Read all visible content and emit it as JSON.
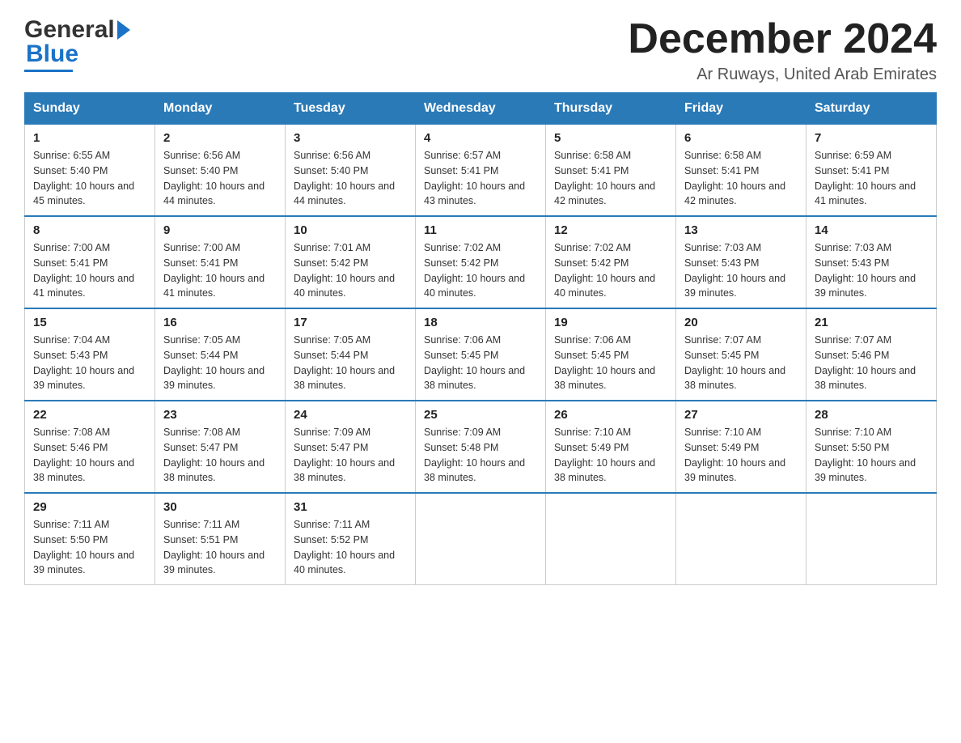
{
  "header": {
    "logo_general": "General",
    "logo_blue": "Blue",
    "month_title": "December 2024",
    "subtitle": "Ar Ruways, United Arab Emirates"
  },
  "weekdays": [
    "Sunday",
    "Monday",
    "Tuesday",
    "Wednesday",
    "Thursday",
    "Friday",
    "Saturday"
  ],
  "weeks": [
    [
      {
        "day": "1",
        "sunrise": "6:55 AM",
        "sunset": "5:40 PM",
        "daylight": "10 hours and 45 minutes."
      },
      {
        "day": "2",
        "sunrise": "6:56 AM",
        "sunset": "5:40 PM",
        "daylight": "10 hours and 44 minutes."
      },
      {
        "day": "3",
        "sunrise": "6:56 AM",
        "sunset": "5:40 PM",
        "daylight": "10 hours and 44 minutes."
      },
      {
        "day": "4",
        "sunrise": "6:57 AM",
        "sunset": "5:41 PM",
        "daylight": "10 hours and 43 minutes."
      },
      {
        "day": "5",
        "sunrise": "6:58 AM",
        "sunset": "5:41 PM",
        "daylight": "10 hours and 42 minutes."
      },
      {
        "day": "6",
        "sunrise": "6:58 AM",
        "sunset": "5:41 PM",
        "daylight": "10 hours and 42 minutes."
      },
      {
        "day": "7",
        "sunrise": "6:59 AM",
        "sunset": "5:41 PM",
        "daylight": "10 hours and 41 minutes."
      }
    ],
    [
      {
        "day": "8",
        "sunrise": "7:00 AM",
        "sunset": "5:41 PM",
        "daylight": "10 hours and 41 minutes."
      },
      {
        "day": "9",
        "sunrise": "7:00 AM",
        "sunset": "5:41 PM",
        "daylight": "10 hours and 41 minutes."
      },
      {
        "day": "10",
        "sunrise": "7:01 AM",
        "sunset": "5:42 PM",
        "daylight": "10 hours and 40 minutes."
      },
      {
        "day": "11",
        "sunrise": "7:02 AM",
        "sunset": "5:42 PM",
        "daylight": "10 hours and 40 minutes."
      },
      {
        "day": "12",
        "sunrise": "7:02 AM",
        "sunset": "5:42 PM",
        "daylight": "10 hours and 40 minutes."
      },
      {
        "day": "13",
        "sunrise": "7:03 AM",
        "sunset": "5:43 PM",
        "daylight": "10 hours and 39 minutes."
      },
      {
        "day": "14",
        "sunrise": "7:03 AM",
        "sunset": "5:43 PM",
        "daylight": "10 hours and 39 minutes."
      }
    ],
    [
      {
        "day": "15",
        "sunrise": "7:04 AM",
        "sunset": "5:43 PM",
        "daylight": "10 hours and 39 minutes."
      },
      {
        "day": "16",
        "sunrise": "7:05 AM",
        "sunset": "5:44 PM",
        "daylight": "10 hours and 39 minutes."
      },
      {
        "day": "17",
        "sunrise": "7:05 AM",
        "sunset": "5:44 PM",
        "daylight": "10 hours and 38 minutes."
      },
      {
        "day": "18",
        "sunrise": "7:06 AM",
        "sunset": "5:45 PM",
        "daylight": "10 hours and 38 minutes."
      },
      {
        "day": "19",
        "sunrise": "7:06 AM",
        "sunset": "5:45 PM",
        "daylight": "10 hours and 38 minutes."
      },
      {
        "day": "20",
        "sunrise": "7:07 AM",
        "sunset": "5:45 PM",
        "daylight": "10 hours and 38 minutes."
      },
      {
        "day": "21",
        "sunrise": "7:07 AM",
        "sunset": "5:46 PM",
        "daylight": "10 hours and 38 minutes."
      }
    ],
    [
      {
        "day": "22",
        "sunrise": "7:08 AM",
        "sunset": "5:46 PM",
        "daylight": "10 hours and 38 minutes."
      },
      {
        "day": "23",
        "sunrise": "7:08 AM",
        "sunset": "5:47 PM",
        "daylight": "10 hours and 38 minutes."
      },
      {
        "day": "24",
        "sunrise": "7:09 AM",
        "sunset": "5:47 PM",
        "daylight": "10 hours and 38 minutes."
      },
      {
        "day": "25",
        "sunrise": "7:09 AM",
        "sunset": "5:48 PM",
        "daylight": "10 hours and 38 minutes."
      },
      {
        "day": "26",
        "sunrise": "7:10 AM",
        "sunset": "5:49 PM",
        "daylight": "10 hours and 38 minutes."
      },
      {
        "day": "27",
        "sunrise": "7:10 AM",
        "sunset": "5:49 PM",
        "daylight": "10 hours and 39 minutes."
      },
      {
        "day": "28",
        "sunrise": "7:10 AM",
        "sunset": "5:50 PM",
        "daylight": "10 hours and 39 minutes."
      }
    ],
    [
      {
        "day": "29",
        "sunrise": "7:11 AM",
        "sunset": "5:50 PM",
        "daylight": "10 hours and 39 minutes."
      },
      {
        "day": "30",
        "sunrise": "7:11 AM",
        "sunset": "5:51 PM",
        "daylight": "10 hours and 39 minutes."
      },
      {
        "day": "31",
        "sunrise": "7:11 AM",
        "sunset": "5:52 PM",
        "daylight": "10 hours and 40 minutes."
      },
      null,
      null,
      null,
      null
    ]
  ],
  "labels": {
    "sunrise_prefix": "Sunrise: ",
    "sunset_prefix": "Sunset: ",
    "daylight_prefix": "Daylight: "
  }
}
